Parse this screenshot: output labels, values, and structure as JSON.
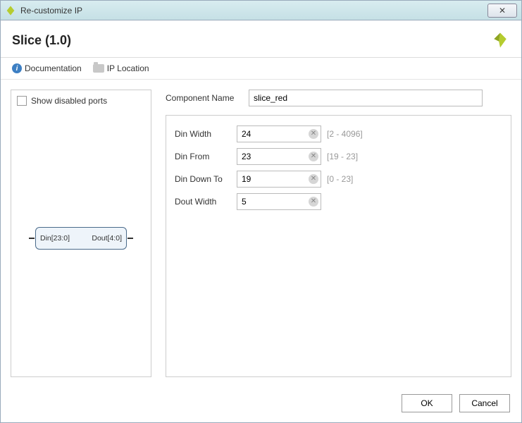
{
  "window": {
    "title": "Re-customize IP"
  },
  "header": {
    "title": "Slice (1.0)"
  },
  "toolbar": {
    "documentation": "Documentation",
    "ip_location": "IP Location"
  },
  "left": {
    "show_disabled_label": "Show disabled ports",
    "block": {
      "din": "Din[23:0]",
      "dout": "Dout[4:0]"
    }
  },
  "comp_name": {
    "label": "Component Name",
    "value": "slice_red"
  },
  "params": [
    {
      "label": "Din Width",
      "value": "24",
      "hint": "[2 - 4096]"
    },
    {
      "label": "Din From",
      "value": "23",
      "hint": "[19 - 23]"
    },
    {
      "label": "Din Down To",
      "value": "19",
      "hint": "[0 - 23]"
    },
    {
      "label": "Dout Width",
      "value": "5",
      "hint": ""
    }
  ],
  "footer": {
    "ok": "OK",
    "cancel": "Cancel"
  },
  "colors": {
    "accent": "#b5cc2f"
  }
}
